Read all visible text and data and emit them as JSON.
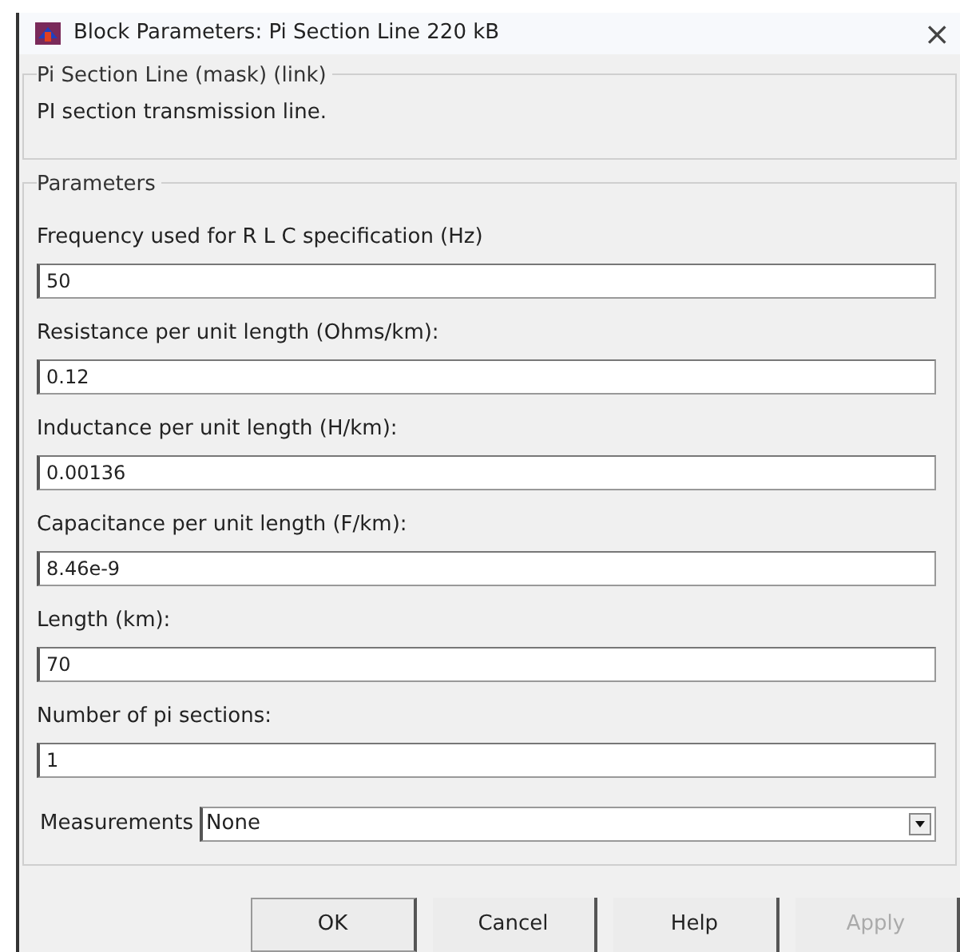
{
  "window": {
    "title": "Block Parameters: Pi Section Line 220 kB",
    "close": "×"
  },
  "block": {
    "title": "Pi Section Line (mask) (link)",
    "description": "PI section transmission line."
  },
  "parameters": {
    "title": "Parameters",
    "fields": [
      {
        "label": "Frequency used for R L C specification (Hz)",
        "value": "50"
      },
      {
        "label": "Resistance per unit length (Ohms/km):",
        "value": "0.12"
      },
      {
        "label": "Inductance per unit length (H/km):",
        "value": "0.00136"
      },
      {
        "label": "Capacitance per unit length (F/km):",
        "value": "8.46e-9"
      },
      {
        "label": "Length (km):",
        "value": "70"
      },
      {
        "label": "Number of pi sections:",
        "value": "1"
      }
    ],
    "measurements": {
      "label": "Measurements",
      "value": "None"
    }
  },
  "buttons": [
    {
      "label": "OK",
      "disabled": false
    },
    {
      "label": "Cancel",
      "disabled": false
    },
    {
      "label": "Help",
      "disabled": false
    },
    {
      "label": "Apply",
      "disabled": true
    }
  ]
}
